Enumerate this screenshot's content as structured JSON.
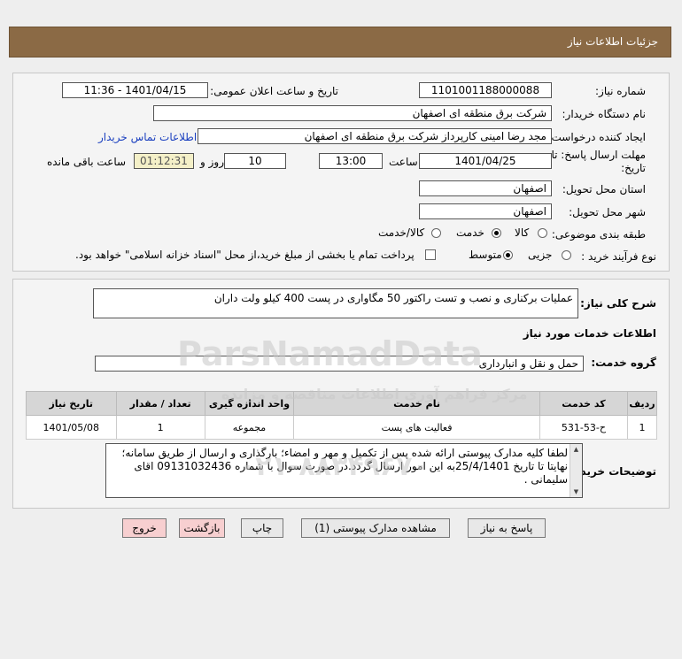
{
  "header": {
    "title": "جزئیات اطلاعات نیاز"
  },
  "fields": {
    "need_number_label": "شماره نیاز:",
    "need_number": "1101001188000088",
    "announce_label": "تاریخ و ساعت اعلان عمومی:",
    "announce_value": "1401/04/15 - 11:36",
    "buyer_org_label": "نام دستگاه خریدار:",
    "buyer_org": "شرکت برق منطقه ای اصفهان",
    "requester_label": "ایجاد کننده درخواست:",
    "requester": "مجد رضا امینی کارپرداز شرکت برق منطقه ای اصفهان",
    "contact_link": "اطلاعات تماس خریدار",
    "deadline_label_1": "مهلت ارسال پاسخ: تا",
    "deadline_label_2": "تاریخ:",
    "deadline_date": "1401/04/25",
    "time_label": "ساعت",
    "deadline_time": "13:00",
    "days_value": "10",
    "days_label": "روز و",
    "remaining_time": "01:12:31",
    "remaining_label": "ساعت باقی مانده",
    "province_label": "استان محل تحویل:",
    "province": "اصفهان",
    "city_label": "شهر محل تحویل:",
    "city": "اصفهان",
    "category_label": "طبقه بندی موضوعی:",
    "category_options": [
      "کالا",
      "خدمت",
      "کالا/خدمت"
    ],
    "process_label": "نوع فرآیند خرید :",
    "process_options": [
      "جزیی",
      "متوسط"
    ],
    "payment_note": "پرداخت تمام یا بخشی از مبلغ خرید،از محل \"اسناد خزانه اسلامی\" خواهد بود."
  },
  "summary": {
    "label": "شرح کلی نیاز:",
    "value": "عملیات برکناری و نصب و تست راکتور 50 مگاواری در پست 400 کیلو ولت داران",
    "services_heading": "اطلاعات خدمات مورد نیاز",
    "group_label": "گروه خدمت:",
    "group_value": "حمل و نقل و انبارداری"
  },
  "table": {
    "headers": [
      "ردیف",
      "کد خدمت",
      "نام خدمت",
      "واحد اندازه گیری",
      "تعداد / مقدار",
      "تاریخ نیاز"
    ],
    "rows": [
      [
        "1",
        "ح-53-531",
        "فعالیت های پست",
        "مجموعه",
        "1",
        "1401/05/08"
      ]
    ]
  },
  "notes": {
    "label": "توضیحات خریدار:",
    "text": "لطفا کلیه مدارک پیوستی ارائه شده  پس از تکمیل و مهر و امضاء؛ بارگذاری و ارسال از طریق سامانه؛ نهایتا تا تاریخ 25/4/1401به این امور ارسال گردد.در صورت سوال با شماره 09131032436 اقای سلیمانی ."
  },
  "buttons": {
    "reply": "پاسخ به نیاز",
    "attachments": "مشاهده مدارک پیوستی (1)",
    "print": "چاپ",
    "back": "بازگشت",
    "exit": "خروج"
  },
  "watermark": {
    "line1": "ParsNamadData",
    "line2": "مرکز فراهم آوری اطلاعات مناقصه و مزایده",
    "phone": "۰۲۱-۸۸۳۴۹۶۷۰"
  }
}
